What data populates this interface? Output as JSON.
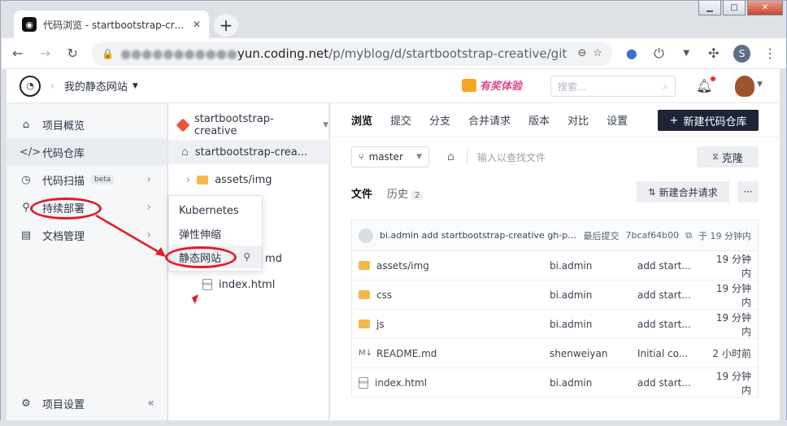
{
  "browser": {
    "tab_title": "代码浏览 - startbootstrap-creative",
    "tab_close": "✕",
    "new_tab": "+",
    "url_host_hidden": "●●●●●●●●●●●",
    "url_host_visible": "yun.coding.net",
    "url_path": "/p/myblog/d/startbootstrap-creative/git",
    "profile_initial": "S"
  },
  "header": {
    "project_name": "我的静态网站",
    "promo": "有奖体验",
    "search_placeholder": "搜索..."
  },
  "sidebar": {
    "items": [
      {
        "label": "项目概览",
        "icon": "house-icon"
      },
      {
        "label": "代码仓库",
        "icon": "code-icon"
      },
      {
        "label": "代码扫描",
        "icon": "scan-icon",
        "badge": "beta"
      },
      {
        "label": "持续部署",
        "icon": "rocket-icon"
      },
      {
        "label": "文档管理",
        "icon": "doc-icon"
      }
    ],
    "settings_label": "项目设置"
  },
  "tree": {
    "repo_name": "startbootstrap-creative",
    "root_label": "startbootstrap-crea...",
    "items": [
      {
        "label": "assets/img",
        "type": "folder"
      },
      {
        "label": "md",
        "type": "file"
      },
      {
        "label": "index.html",
        "type": "file"
      }
    ]
  },
  "deploy_menu": {
    "items": [
      "Kubernetes",
      "弹性伸缩",
      "静态网站"
    ]
  },
  "main": {
    "tabs": [
      "浏览",
      "提交",
      "分支",
      "合并请求",
      "版本",
      "对比",
      "设置"
    ],
    "new_repo_label": "新建代码仓库",
    "branch": "master",
    "find_placeholder": "输入以查找文件",
    "clone_label": "克隆",
    "sub_tabs": {
      "files": "文件",
      "history": "历史",
      "history_count": "2"
    },
    "new_mr_label": "新建合并请求",
    "more_label": "···",
    "commit": {
      "message": "bi.admin add startbootstrap-creative gh-pag...",
      "last_commit_label": "最后提交",
      "hash": "7bcaf64b00",
      "time": "于 19 分钟内"
    },
    "files": [
      {
        "name": "assets/img",
        "type": "folder",
        "author": "bi.admin",
        "message": "add start...",
        "time": "19 分钟内"
      },
      {
        "name": "css",
        "type": "folder",
        "author": "bi.admin",
        "message": "add start...",
        "time": "19 分钟内"
      },
      {
        "name": "js",
        "type": "folder",
        "author": "bi.admin",
        "message": "add start...",
        "time": "19 分钟内"
      },
      {
        "name": "README.md",
        "type": "md",
        "author": "shenweiyan",
        "message": "Initial co...",
        "time": "2 小时前"
      },
      {
        "name": "index.html",
        "type": "html",
        "author": "bi.admin",
        "message": "add start...",
        "time": "19 分钟内"
      }
    ]
  },
  "colors": {
    "annotation": "#e01e25",
    "primary_button": "#1c2436",
    "folder": "#f2b94a"
  }
}
